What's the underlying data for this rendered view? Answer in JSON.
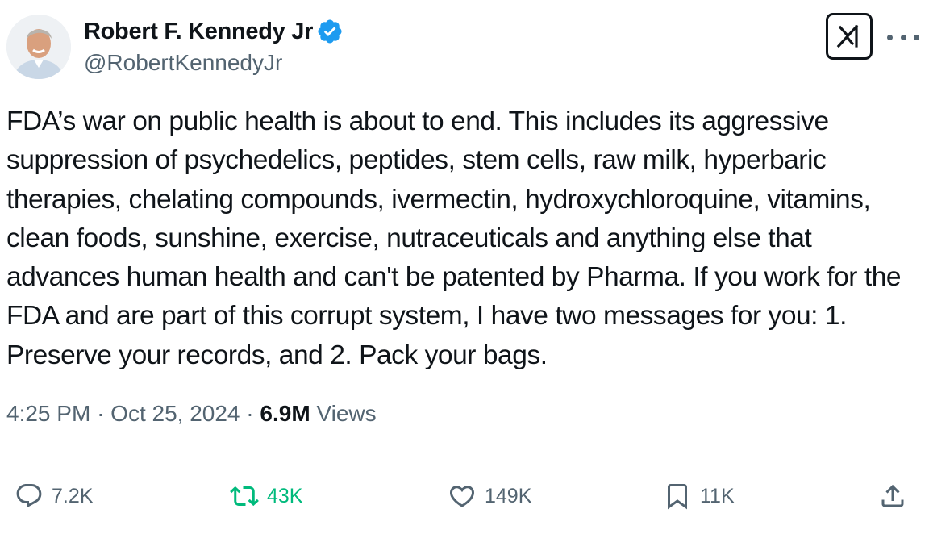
{
  "tweet": {
    "author": {
      "display_name": "Robert F. Kennedy Jr",
      "handle": "@RobertKennedyJr",
      "verified": true
    },
    "text": "FDA’s war on public health is about to end. This includes its aggressive suppression of psychedelics, peptides, stem cells, raw milk, hyperbaric therapies, chelating compounds, ivermectin, hydroxychloroquine, vitamins, clean foods, sunshine, exercise, nutraceuticals and anything else that advances human health and can't be patented by Pharma. If you work for the FDA and are part of this corrupt system, I have two messages for you: 1. Preserve your records, and 2. Pack your bags.",
    "time": "4:25 PM",
    "separator": "·",
    "date": "Oct 25, 2024",
    "views_count": "6.9M",
    "views_label": "Views"
  },
  "actions": {
    "reply_count": "7.2K",
    "retweet_count": "43K",
    "like_count": "149K",
    "bookmark_count": "11K"
  },
  "icons": {
    "verified": "verified-badge-icon",
    "grok": "grok-icon",
    "more": "more-icon",
    "reply": "reply-icon",
    "retweet": "retweet-icon",
    "like": "heart-icon",
    "bookmark": "bookmark-icon",
    "share": "share-icon"
  },
  "colors": {
    "verified_blue": "#1d9bf0",
    "text_primary": "#0f1419",
    "text_secondary": "#536471",
    "retweet_green": "#00ba7c"
  }
}
